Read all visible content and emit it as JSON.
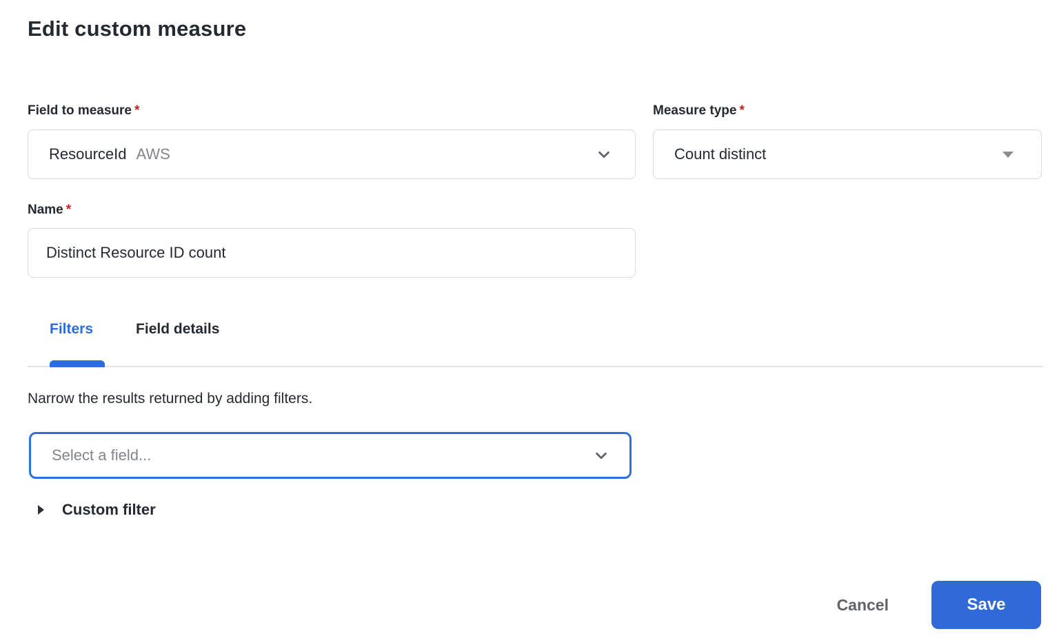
{
  "title": "Edit custom measure",
  "required_marker": "*",
  "accent_color": "#2d6ce0",
  "required_color": "#c5221f",
  "fields": {
    "field_to_measure": {
      "label": "Field to measure",
      "required": true,
      "value": "ResourceId",
      "value_suffix": "AWS"
    },
    "measure_type": {
      "label": "Measure type",
      "required": true,
      "value": "Count distinct"
    },
    "name": {
      "label": "Name",
      "required": true,
      "value": "Distinct Resource ID count"
    }
  },
  "tabs": [
    {
      "label": "Filters",
      "active": true
    },
    {
      "label": "Field details",
      "active": false
    }
  ],
  "filters_tab": {
    "hint": "Narrow the results returned by adding filters.",
    "field_select_placeholder": "Select a field...",
    "custom_filter_label": "Custom filter"
  },
  "footer": {
    "cancel_label": "Cancel",
    "save_label": "Save"
  }
}
